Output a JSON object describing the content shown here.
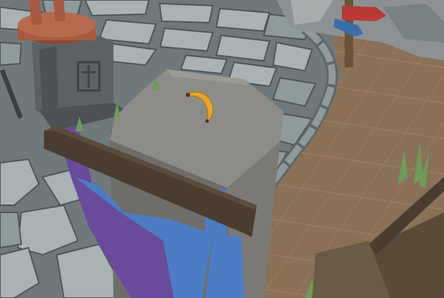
{
  "scene": {
    "colors": {
      "ground": "#8a7055",
      "ground_grid": "#b89f80",
      "cobble_light": "#a9b3b3",
      "cobble_mid": "#8f9a9b",
      "cobble_dark": "#6f797b",
      "cobble_edge": "#4c5557",
      "pedestal_top": "#8d8c88",
      "pedestal_side": "#6e6d69",
      "pedestal_front": "#7a7975",
      "banana": "#e8a52b",
      "banner_purple": "#6a4a9a",
      "banner_blue": "#4b7cc4",
      "beam": "#4a3c2e",
      "gravestone": "#5e6164",
      "urn": "#a85a40",
      "sign_red": "#b83a34",
      "sign_blue": "#3a6ea8",
      "grass": "#6e9a5a"
    },
    "objects": [
      {
        "name": "stone-pedestal"
      },
      {
        "name": "banana-pickup"
      },
      {
        "name": "purple-blue-banner"
      },
      {
        "name": "wooden-crossbeam"
      },
      {
        "name": "gravestone-cross"
      },
      {
        "name": "clay-urn"
      },
      {
        "name": "wooden-signpost"
      },
      {
        "name": "grass-tuft"
      }
    ]
  }
}
